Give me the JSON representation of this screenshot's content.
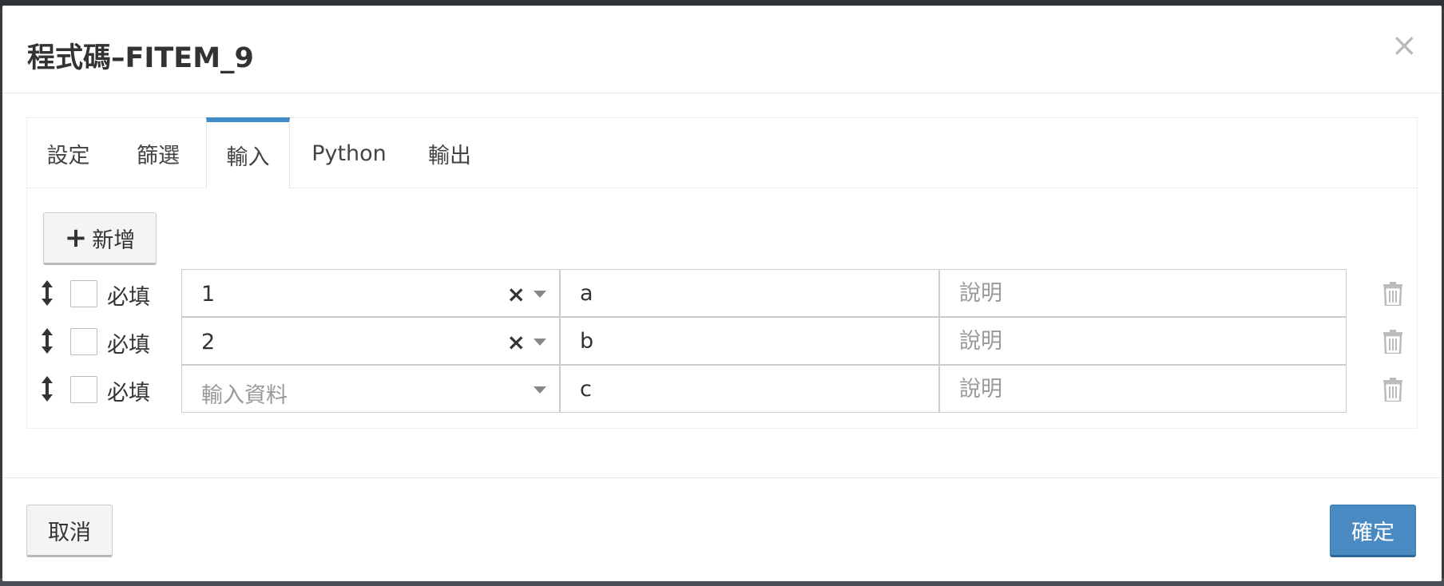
{
  "dialog": {
    "title": "程式碼–FITEM_9",
    "close_label": "×"
  },
  "tabs": [
    {
      "label": "設定",
      "active": false
    },
    {
      "label": "篩選",
      "active": false
    },
    {
      "label": "輸入",
      "active": true
    },
    {
      "label": "Python",
      "active": false
    },
    {
      "label": "輸出",
      "active": false
    }
  ],
  "toolbar": {
    "add_icon": "+",
    "add_label": "新增"
  },
  "inputs": [
    {
      "required_label": "必填",
      "required": false,
      "source_value": "1",
      "source_placeholder": "",
      "clearable": true,
      "name": "a",
      "description_placeholder": "說明"
    },
    {
      "required_label": "必填",
      "required": false,
      "source_value": "2",
      "source_placeholder": "",
      "clearable": true,
      "name": "b",
      "description_placeholder": "說明"
    },
    {
      "required_label": "必填",
      "required": false,
      "source_value": "",
      "source_placeholder": "輸入資料",
      "clearable": false,
      "name": "c",
      "description_placeholder": "說明"
    }
  ],
  "clear_glyph": "×",
  "footer": {
    "cancel_label": "取消",
    "confirm_label": "確定"
  },
  "colors": {
    "accent": "#428bca",
    "primary_button": "#4a8ac3"
  },
  "icons": {
    "drag": "drag-handle-icon",
    "trash": "trash-icon",
    "caret": "caret-down-icon",
    "clear": "clear-icon",
    "close": "close-icon",
    "plus": "plus-icon"
  }
}
